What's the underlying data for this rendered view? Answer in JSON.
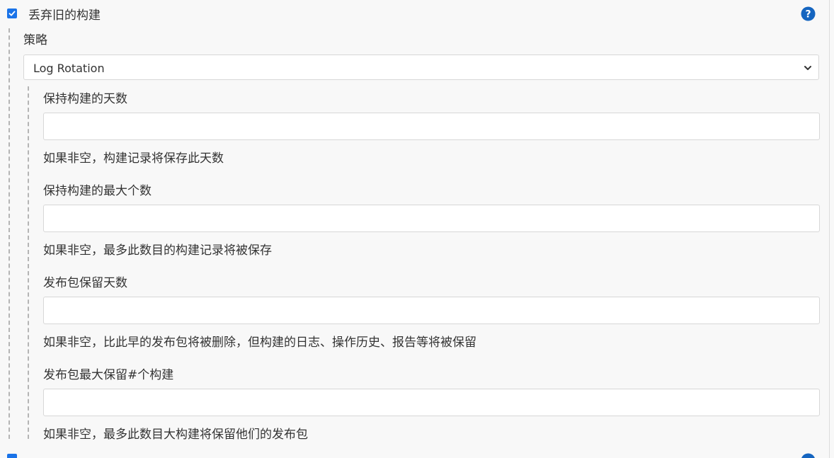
{
  "discard_old_builds": {
    "label": "丢弃旧的构建",
    "checked": true
  },
  "strategy": {
    "label": "策略",
    "selected": "Log Rotation"
  },
  "fields": [
    {
      "label": "保持构建的天数",
      "value": "",
      "help": "如果非空，构建记录将保存此天数"
    },
    {
      "label": "保持构建的最大个数",
      "value": "",
      "help": "如果非空，最多此数目的构建记录将被保存"
    },
    {
      "label": "发布包保留天数",
      "value": "",
      "help": "如果非空，比此早的发布包将被删除，但构建的日志、操作历史、报告等将被保留"
    },
    {
      "label": "发布包最大保留#个构建",
      "value": "",
      "help": "如果非空，最多此数目大构建将保留他们的发布包"
    }
  ],
  "colors": {
    "accent": "#1a73e8",
    "help_icon": "#1565c0"
  }
}
